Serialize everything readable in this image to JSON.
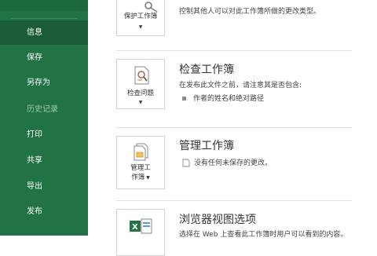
{
  "sidebar": {
    "items": [
      {
        "label": "信息",
        "active": true
      },
      {
        "label": "保存"
      },
      {
        "label": "另存为"
      },
      {
        "label": "历史记录",
        "disabled": true
      },
      {
        "label": "打印"
      },
      {
        "label": "共享"
      },
      {
        "label": "导出"
      },
      {
        "label": "发布"
      }
    ]
  },
  "protect": {
    "button_label": "保护工作簿",
    "description": "控制其他人可以对此工作簿所做的更改类型。"
  },
  "inspect": {
    "title": "检查工作簿",
    "button_label": "检查问题",
    "description": "在发布此文件之前，请注意其是否包含:",
    "bullet": "作者的姓名和绝对路径"
  },
  "manage": {
    "title": "管理工作簿",
    "button_label_line1": "管理工",
    "button_label_line2": "作簿",
    "status": "没有任何未保存的更改。"
  },
  "browser": {
    "title": "浏览器视图选项",
    "description": "选择在 Web 上查看此工作簿时用户可以看到的内容。"
  },
  "colors": {
    "sidebar": "#217346",
    "sidebar_active": "#1a5c37"
  }
}
